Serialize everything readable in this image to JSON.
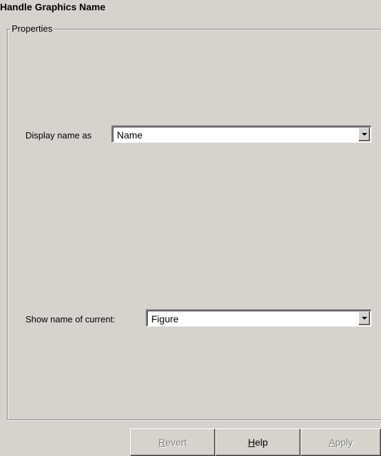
{
  "header": {
    "title": "Handle Graphics Name"
  },
  "properties": {
    "legend": "Properties",
    "display_name": {
      "label": "Display name as",
      "value": "Name"
    },
    "show_name": {
      "label": "Show name of current:",
      "value": "Figure"
    }
  },
  "footer": {
    "revert": {
      "mnemonic": "R",
      "rest": "evert",
      "enabled": false
    },
    "help": {
      "mnemonic": "H",
      "rest": "elp",
      "enabled": true
    },
    "apply": {
      "mnemonic": "A",
      "rest": "pply",
      "enabled": false
    }
  },
  "icons": {
    "combo_arrow": "chevron-down-icon"
  }
}
